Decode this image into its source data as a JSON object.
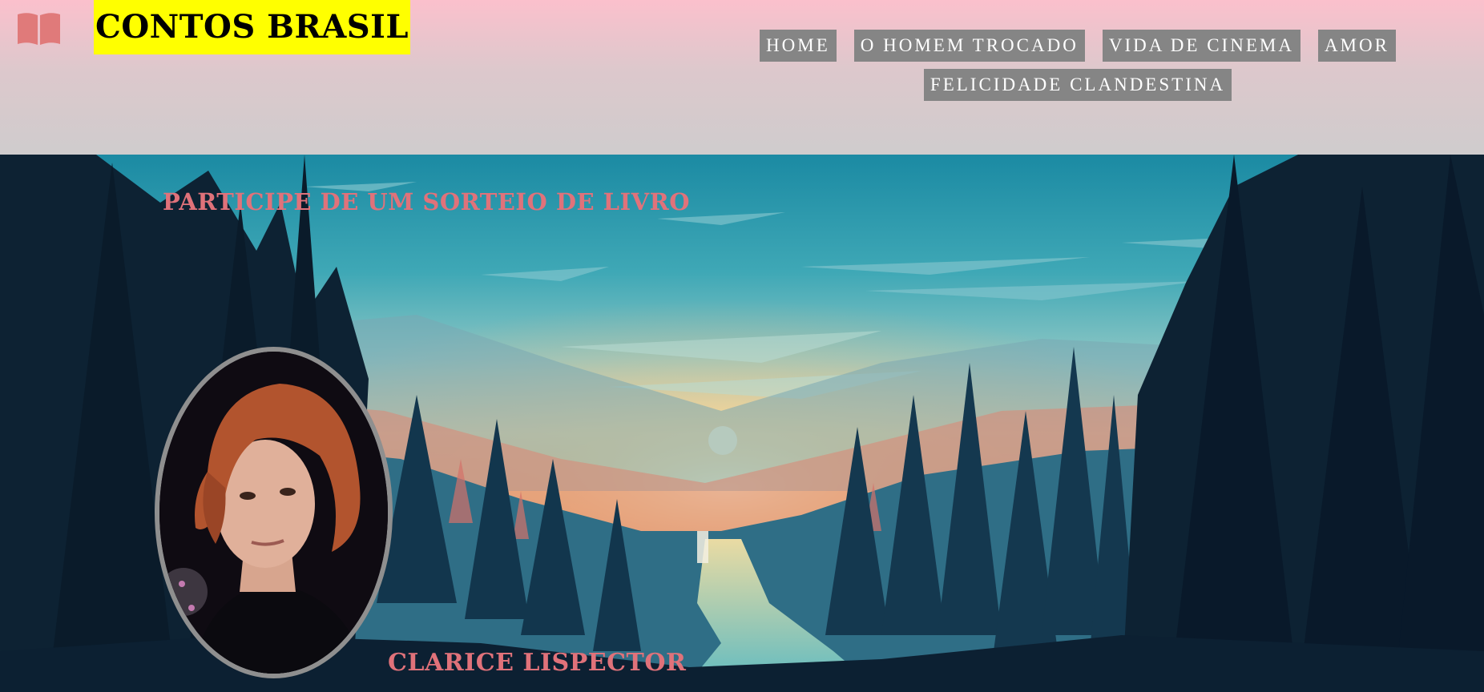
{
  "header": {
    "logo_icon": "open-book-icon",
    "brand_title": "CONTOS BRASIL",
    "colors": {
      "header_gradient_top": "#fbc0cc",
      "header_gradient_bottom": "#cfcccd",
      "brand_highlight": "#ffff00",
      "logo_color": "#e07a7a"
    }
  },
  "nav": {
    "items": [
      {
        "label": "HOME"
      },
      {
        "label": "O HOMEM TROCADO"
      },
      {
        "label": "VIDA DE CINEMA"
      },
      {
        "label": "AMOR"
      },
      {
        "label": "FELICIDADE CLANDESTINA"
      }
    ],
    "colors": {
      "background": "#858585",
      "text": "#ffffff"
    }
  },
  "hero": {
    "background": "forest-sunset-illustration",
    "giveaway_heading": "PARTICIPE DE UM SORTEIO DE LIVRO",
    "author_photo": "author-portrait",
    "author_name": "CLARICE LISPECTOR",
    "colors": {
      "accent_text": "#e0727a",
      "portrait_border": "#8f8f8f"
    }
  }
}
